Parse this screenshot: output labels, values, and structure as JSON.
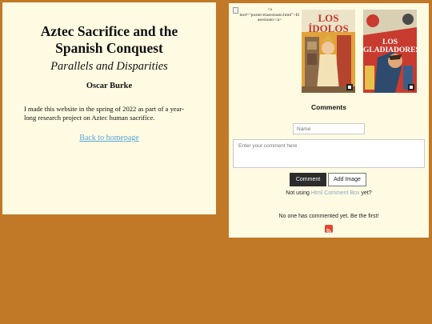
{
  "left": {
    "title_line1": "Aztec Sacrifice and the",
    "title_line2": "Spanish Conquest",
    "subtitle": "Parallels and Disparities",
    "author": "Oscar Burke",
    "description": "I made this website in the spring of 2022 as part of a year-long research project on Aztec human sacrifice.",
    "back_link": "Back to homepage"
  },
  "right": {
    "broken_image_alt": "<a href=\"poster/elasesinato.html\">El asesinato</a>",
    "poster1_title_line1": "LOS",
    "poster1_title_line2": "ÍDOLOS",
    "poster2_title_line1": "LOS",
    "poster2_title_line2": "GLADIADORES",
    "comments_heading": "Comments",
    "name_placeholder": "Name",
    "comment_placeholder": "Enter your comment here",
    "comment_button": "Comment",
    "add_image_button": "Add Image",
    "not_using_prefix": "Not using ",
    "not_using_link": "Html Comment Box",
    "not_using_suffix": "  yet?",
    "no_comments": "No one has commented yet. Be the first!",
    "icons": {
      "rss": "rss-icon",
      "qr": "qr-code-icon"
    }
  },
  "colors": {
    "background": "#c17827",
    "panel": "#fffbe3",
    "link": "#5aa6d6",
    "button_dark": "#2c2c2c",
    "rss": "#e0472f"
  }
}
